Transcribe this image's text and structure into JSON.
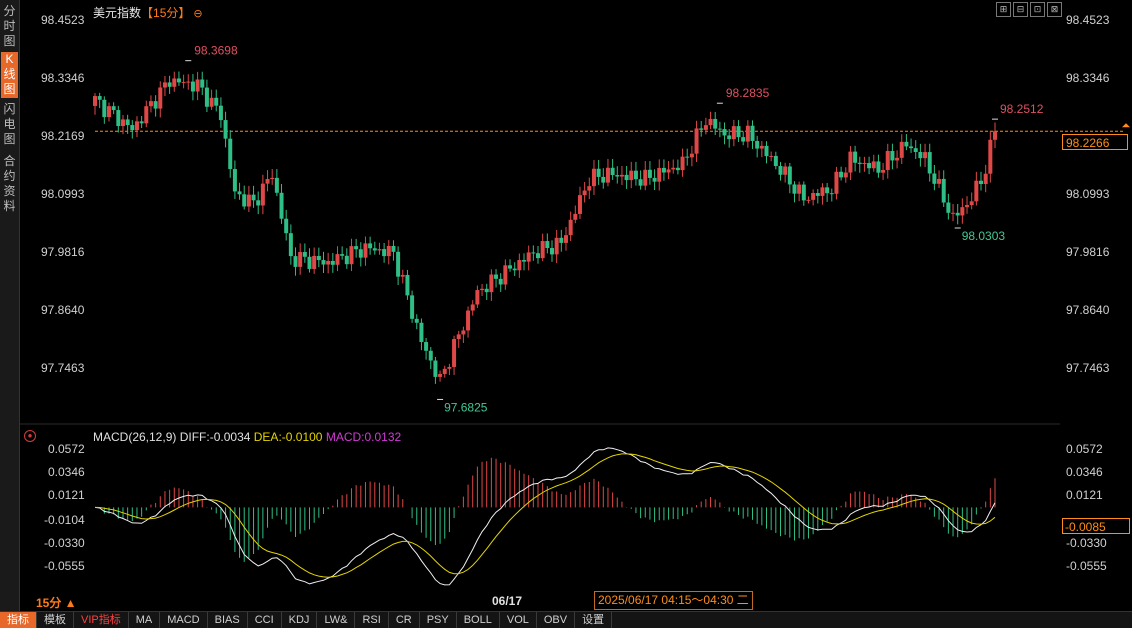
{
  "left_tabs": [
    {
      "label": "分时图",
      "active": false
    },
    {
      "label": "K线图",
      "active": true
    },
    {
      "label": "闪电图",
      "active": false
    },
    {
      "label": "合约资料",
      "active": false
    }
  ],
  "header": {
    "title": "美元指数",
    "period": "【15分】",
    "period_icon": "⊖"
  },
  "window_tools": [
    "⊞",
    "⊟",
    "⊡",
    "⊠"
  ],
  "price_axis": {
    "ticks": [
      "98.4523",
      "98.3346",
      "98.2169",
      "98.0993",
      "97.9816",
      "97.8640",
      "97.7463"
    ],
    "current_price": "98.2266"
  },
  "annotations": {
    "high1": "98.3698",
    "high2": "98.2835",
    "last_high": "98.2512",
    "low1": "97.6825",
    "low2": "98.0303"
  },
  "macd": {
    "title": "MACD(26,12,9)",
    "diff": "DIFF:-0.0034",
    "dea": "DEA:-0.0100",
    "macd": "MACD:0.0132",
    "ticks": [
      "0.0572",
      "0.0346",
      "0.0121",
      "-0.0104",
      "-0.0330",
      "-0.0555"
    ],
    "current": "-0.0085",
    "colors": {
      "diff": "#f0f0f0",
      "dea": "#e3d400",
      "macd": "#d23ad6",
      "up": "#e04848",
      "down": "#2fbf86"
    }
  },
  "footer": {
    "period": "15分 ▲",
    "date": "06/17",
    "time_range": "2025/06/17 04:15～04:30 二"
  },
  "toolbar": [
    "指标",
    "模板",
    "VIP指标",
    "MA",
    "MACD",
    "BIAS",
    "CCI",
    "KDJ",
    "LW&",
    "RSI",
    "CR",
    "PSY",
    "BOLL",
    "VOL",
    "OBV",
    "设置"
  ],
  "chart_data": {
    "type": "candlestick",
    "title": "美元指数【15分】",
    "y_axis_ticks": [
      98.4523,
      98.3346,
      98.2169,
      98.0993,
      97.9816,
      97.864,
      97.7463
    ],
    "ylim": [
      97.68,
      98.47
    ],
    "reference_line": 98.2266,
    "highlighted_values": {
      "max_high": 98.3698,
      "second_high": 98.2835,
      "last_high": 98.2512,
      "min_low": 97.6825,
      "recent_low": 98.0303
    },
    "close_path_anchors": [
      {
        "i": 0,
        "close": 98.29
      },
      {
        "i": 8,
        "close": 98.23
      },
      {
        "i": 16,
        "close": 98.33
      },
      {
        "i": 22,
        "close": 98.32
      },
      {
        "i": 27,
        "close": 98.26
      },
      {
        "i": 30,
        "close": 98.1
      },
      {
        "i": 34,
        "close": 98.08
      },
      {
        "i": 38,
        "close": 98.14
      },
      {
        "i": 42,
        "close": 97.97
      },
      {
        "i": 50,
        "close": 97.96
      },
      {
        "i": 58,
        "close": 97.99
      },
      {
        "i": 64,
        "close": 97.98
      },
      {
        "i": 70,
        "close": 97.8
      },
      {
        "i": 74,
        "close": 97.72
      },
      {
        "i": 77,
        "close": 97.79
      },
      {
        "i": 82,
        "close": 97.9
      },
      {
        "i": 88,
        "close": 97.94
      },
      {
        "i": 94,
        "close": 97.98
      },
      {
        "i": 100,
        "close": 98.0
      },
      {
        "i": 106,
        "close": 98.13
      },
      {
        "i": 110,
        "close": 98.14
      },
      {
        "i": 118,
        "close": 98.13
      },
      {
        "i": 126,
        "close": 98.16
      },
      {
        "i": 131,
        "close": 98.25
      },
      {
        "i": 135,
        "close": 98.22
      },
      {
        "i": 140,
        "close": 98.22
      },
      {
        "i": 146,
        "close": 98.16
      },
      {
        "i": 152,
        "close": 98.09
      },
      {
        "i": 158,
        "close": 98.11
      },
      {
        "i": 162,
        "close": 98.17
      },
      {
        "i": 168,
        "close": 98.15
      },
      {
        "i": 174,
        "close": 98.2
      },
      {
        "i": 178,
        "close": 98.17
      },
      {
        "i": 184,
        "close": 98.05
      },
      {
        "i": 188,
        "close": 98.09
      },
      {
        "i": 191,
        "close": 98.15
      },
      {
        "i": 193,
        "close": 98.23
      }
    ]
  }
}
